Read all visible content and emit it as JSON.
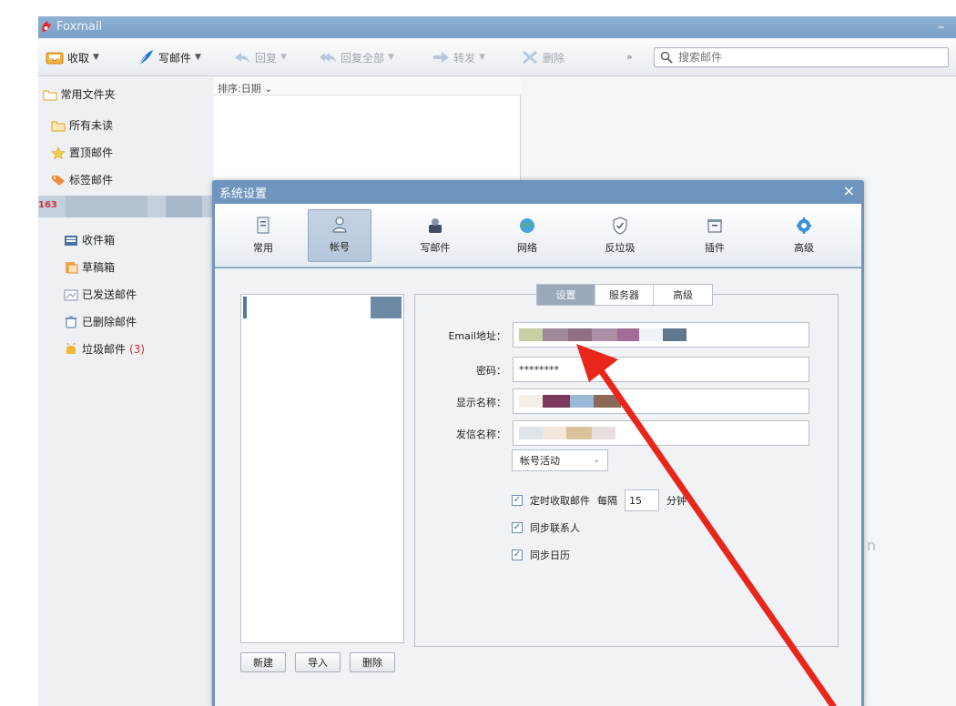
{
  "window": {
    "app_title": "Foxmail",
    "minimize_icon": "minimize-icon"
  },
  "toolbar": {
    "receive_label": "收取",
    "compose_label": "写邮件",
    "reply_label": "回复",
    "reply_all_label": "回复全部",
    "forward_label": "转发",
    "delete_label": "删除",
    "more_label": "»",
    "search_placeholder": "搜索邮件",
    "colors": {
      "accent": "#7aa0c7",
      "disabled_text": "#a2a8b0"
    }
  },
  "sidebar": {
    "group_label": "常用文件夹",
    "items": [
      {
        "label": "所有未读",
        "icon": "folder-icon"
      },
      {
        "label": "置顶邮件",
        "icon": "star-icon"
      },
      {
        "label": "标签邮件",
        "icon": "tag-icon"
      }
    ],
    "account_badge": "163",
    "account_items": [
      {
        "label": "收件箱",
        "icon": "inbox-icon"
      },
      {
        "label": "草稿箱",
        "icon": "drafts-icon"
      },
      {
        "label": "已发送邮件",
        "icon": "sent-icon"
      },
      {
        "label": "已删除邮件",
        "icon": "trash-icon"
      },
      {
        "label": "垃圾邮件",
        "icon": "junk-icon",
        "count": "(3)"
      }
    ]
  },
  "list": {
    "sort_label": "排序:日期 ⌄"
  },
  "watermark": {
    "text": "n"
  },
  "dialog": {
    "title": "系统设置",
    "close": "×",
    "tabs": [
      {
        "label": "常用",
        "icon": "general-icon"
      },
      {
        "label": "帐号",
        "icon": "account-icon",
        "active": true
      },
      {
        "label": "写邮件",
        "icon": "compose-settings-icon"
      },
      {
        "label": "网络",
        "icon": "network-globe-icon"
      },
      {
        "label": "反垃圾",
        "icon": "antispam-shield-icon"
      },
      {
        "label": "插件",
        "icon": "plugin-box-icon"
      },
      {
        "label": "高级",
        "icon": "advanced-gear-icon"
      }
    ],
    "subtabs": [
      "设置",
      "服务器",
      "高级"
    ],
    "active_subtab": "设置",
    "fields": {
      "email_label": "Email地址：",
      "password_label": "密码：",
      "password_value": "********",
      "display_name_label": "显示名称：",
      "sender_name_label": "发信名称："
    },
    "status_select": "帐号活动",
    "options": {
      "auto_receive_label": "定时收取邮件",
      "every_label": "每隔",
      "interval_value": "15",
      "minutes_label": "分钟",
      "sync_contacts_label": "同步联系人",
      "sync_calendar_label": "同步日历"
    },
    "buttons": {
      "new_label": "新建",
      "import_label": "导入",
      "delete_label": "删除"
    }
  },
  "annotation": {
    "arrow_color": "#e8261c"
  }
}
